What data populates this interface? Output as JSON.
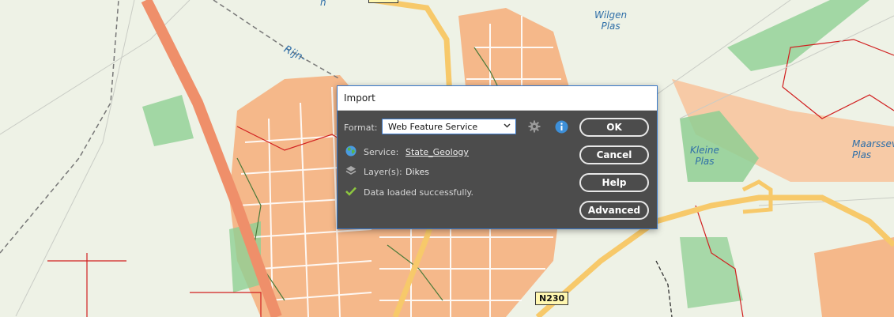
{
  "map": {
    "labels": {
      "wilgen": "Wilgen\nPlas",
      "kleine": "Kleine\nPlas",
      "maarssev": "Maarssev\nPlas",
      "rijn": "Rijn-",
      "top_fragment": "n"
    },
    "road_shield": "N230",
    "colors": {
      "land": "#eef2e6",
      "urban": "#f5b88a",
      "motorway": "#ef8f6a",
      "main_road": "#f7c96a",
      "water_text": "#2f6fa8",
      "green": "#8fcf93",
      "boundary": "#d11f1f"
    }
  },
  "dialog": {
    "title": "Import",
    "format_label": "Format:",
    "format_value": "Web Feature Service",
    "service_label": "Service:",
    "service_value": "State_Geology",
    "layers_label": "Layer(s):",
    "layers_value": "Dikes",
    "status": "Data loaded successfully.",
    "buttons": {
      "ok": "OK",
      "cancel": "Cancel",
      "help": "Help",
      "advanced": "Advanced"
    },
    "icons": {
      "settings": "gear-icon",
      "info": "info-icon",
      "service": "globe-icon",
      "layers": "layers-icon",
      "status": "check-icon"
    },
    "colors": {
      "panel": "#4c4c4c",
      "accent": "#3a78c9",
      "info": "#3d8fd8",
      "success": "#8dc63f"
    }
  }
}
